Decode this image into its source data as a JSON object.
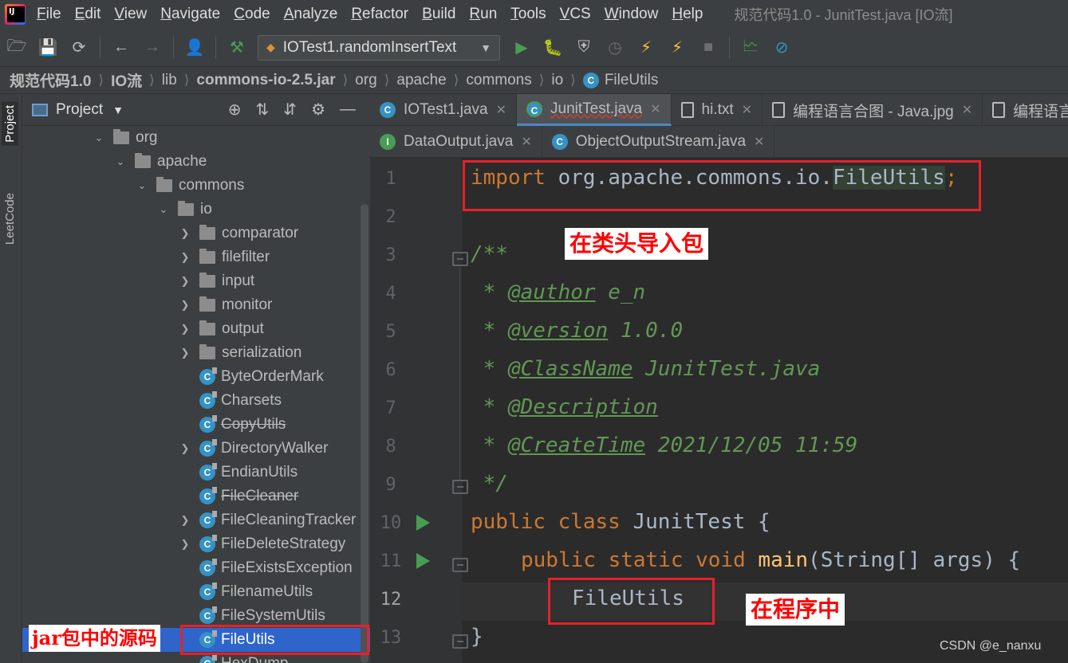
{
  "menu": {
    "items": [
      "File",
      "Edit",
      "View",
      "Navigate",
      "Code",
      "Analyze",
      "Refactor",
      "Build",
      "Run",
      "Tools",
      "VCS",
      "Window",
      "Help"
    ],
    "window_title": "规范代码1.0 - JunitTest.java [IO流]"
  },
  "toolbar": {
    "run_config": "IOTest1.randomInsertText"
  },
  "breadcrumb": [
    "规范代码1.0",
    "IO流",
    "lib",
    "commons-io-2.5.jar",
    "org",
    "apache",
    "commons",
    "io",
    "FileUtils"
  ],
  "left_stripe": {
    "project": "Project",
    "leetcode": "LeetCode"
  },
  "project_panel": {
    "title": "Project",
    "tree": [
      {
        "label": "org",
        "type": "folder",
        "expanded": true,
        "indent": 0
      },
      {
        "label": "apache",
        "type": "folder",
        "expanded": true,
        "indent": 1
      },
      {
        "label": "commons",
        "type": "folder",
        "expanded": true,
        "indent": 2
      },
      {
        "label": "io",
        "type": "folder",
        "expanded": true,
        "indent": 3
      },
      {
        "label": "comparator",
        "type": "folder",
        "expanded": false,
        "indent": 4
      },
      {
        "label": "filefilter",
        "type": "folder",
        "expanded": false,
        "indent": 4
      },
      {
        "label": "input",
        "type": "folder",
        "expanded": false,
        "indent": 4
      },
      {
        "label": "monitor",
        "type": "folder",
        "expanded": false,
        "indent": 4
      },
      {
        "label": "output",
        "type": "folder",
        "expanded": false,
        "indent": 4
      },
      {
        "label": "serialization",
        "type": "folder",
        "expanded": false,
        "indent": 4
      },
      {
        "label": "ByteOrderMark",
        "type": "class",
        "indent": 4
      },
      {
        "label": "Charsets",
        "type": "class",
        "indent": 4
      },
      {
        "label": "CopyUtils",
        "type": "class",
        "indent": 4,
        "deprecated": true
      },
      {
        "label": "DirectoryWalker",
        "type": "class",
        "indent": 4,
        "expandable": true
      },
      {
        "label": "EndianUtils",
        "type": "class",
        "indent": 4
      },
      {
        "label": "FileCleaner",
        "type": "class",
        "indent": 4,
        "deprecated": true
      },
      {
        "label": "FileCleaningTracker",
        "type": "class",
        "indent": 4,
        "expandable": true
      },
      {
        "label": "FileDeleteStrategy",
        "type": "class",
        "indent": 4,
        "expandable": true
      },
      {
        "label": "FileExistsException",
        "type": "class",
        "indent": 4
      },
      {
        "label": "FilenameUtils",
        "type": "class",
        "indent": 4
      },
      {
        "label": "FileSystemUtils",
        "type": "class",
        "indent": 4
      },
      {
        "label": "FileUtils",
        "type": "class",
        "indent": 4,
        "selected": true
      },
      {
        "label": "HexDump",
        "type": "class",
        "indent": 4
      }
    ]
  },
  "editor_tabs_row1": [
    {
      "label": "IOTest1.java",
      "icon": "C",
      "kind": "class"
    },
    {
      "label": "JunitTest.java",
      "icon": "C",
      "kind": "test",
      "active": true
    },
    {
      "label": "hi.txt",
      "icon": "",
      "kind": "txt"
    },
    {
      "label": "编程语言合图 - Java.jpg",
      "icon": "",
      "kind": "img"
    },
    {
      "label": "编程语言",
      "icon": "",
      "kind": "img"
    }
  ],
  "editor_tabs_row2": [
    {
      "label": "DataOutput.java",
      "icon": "I",
      "kind": "iface"
    },
    {
      "label": "ObjectOutputStream.java",
      "icon": "C",
      "kind": "class"
    }
  ],
  "code": {
    "line_numbers": [
      "1",
      "2",
      "3",
      "4",
      "5",
      "6",
      "7",
      "8",
      "9",
      "10",
      "11",
      "12",
      "13"
    ],
    "import_kw": "import",
    "import_pkg": " org.apache.commons.io.",
    "import_cls": "FileUtils",
    "import_end": ";",
    "doc_open": "/**",
    "author_tag": "@author",
    "author_val": " e_n",
    "version_tag": "@version",
    "version_val": " 1.0.0",
    "classname_tag": "@ClassName",
    "classname_val": " JunitTest.java",
    "desc_tag": "@Description",
    "createtime_tag": "@CreateTime",
    "createtime_val": " 2021/12/05 11:59",
    "doc_star": " * ",
    "doc_close": " */",
    "l10_kw": "public class",
    "l10_rest": " JunitTest {",
    "l11_kw": "public static void",
    "l11_fn": "main",
    "l11_rest": "(String[] args) {",
    "l12": "FileUtils",
    "l13": "}"
  },
  "annotations": {
    "import_note": "在类头导入包",
    "program_note": "在程序中",
    "jar_note": "jar包中的源码"
  },
  "watermark": "CSDN @e_nanxu"
}
